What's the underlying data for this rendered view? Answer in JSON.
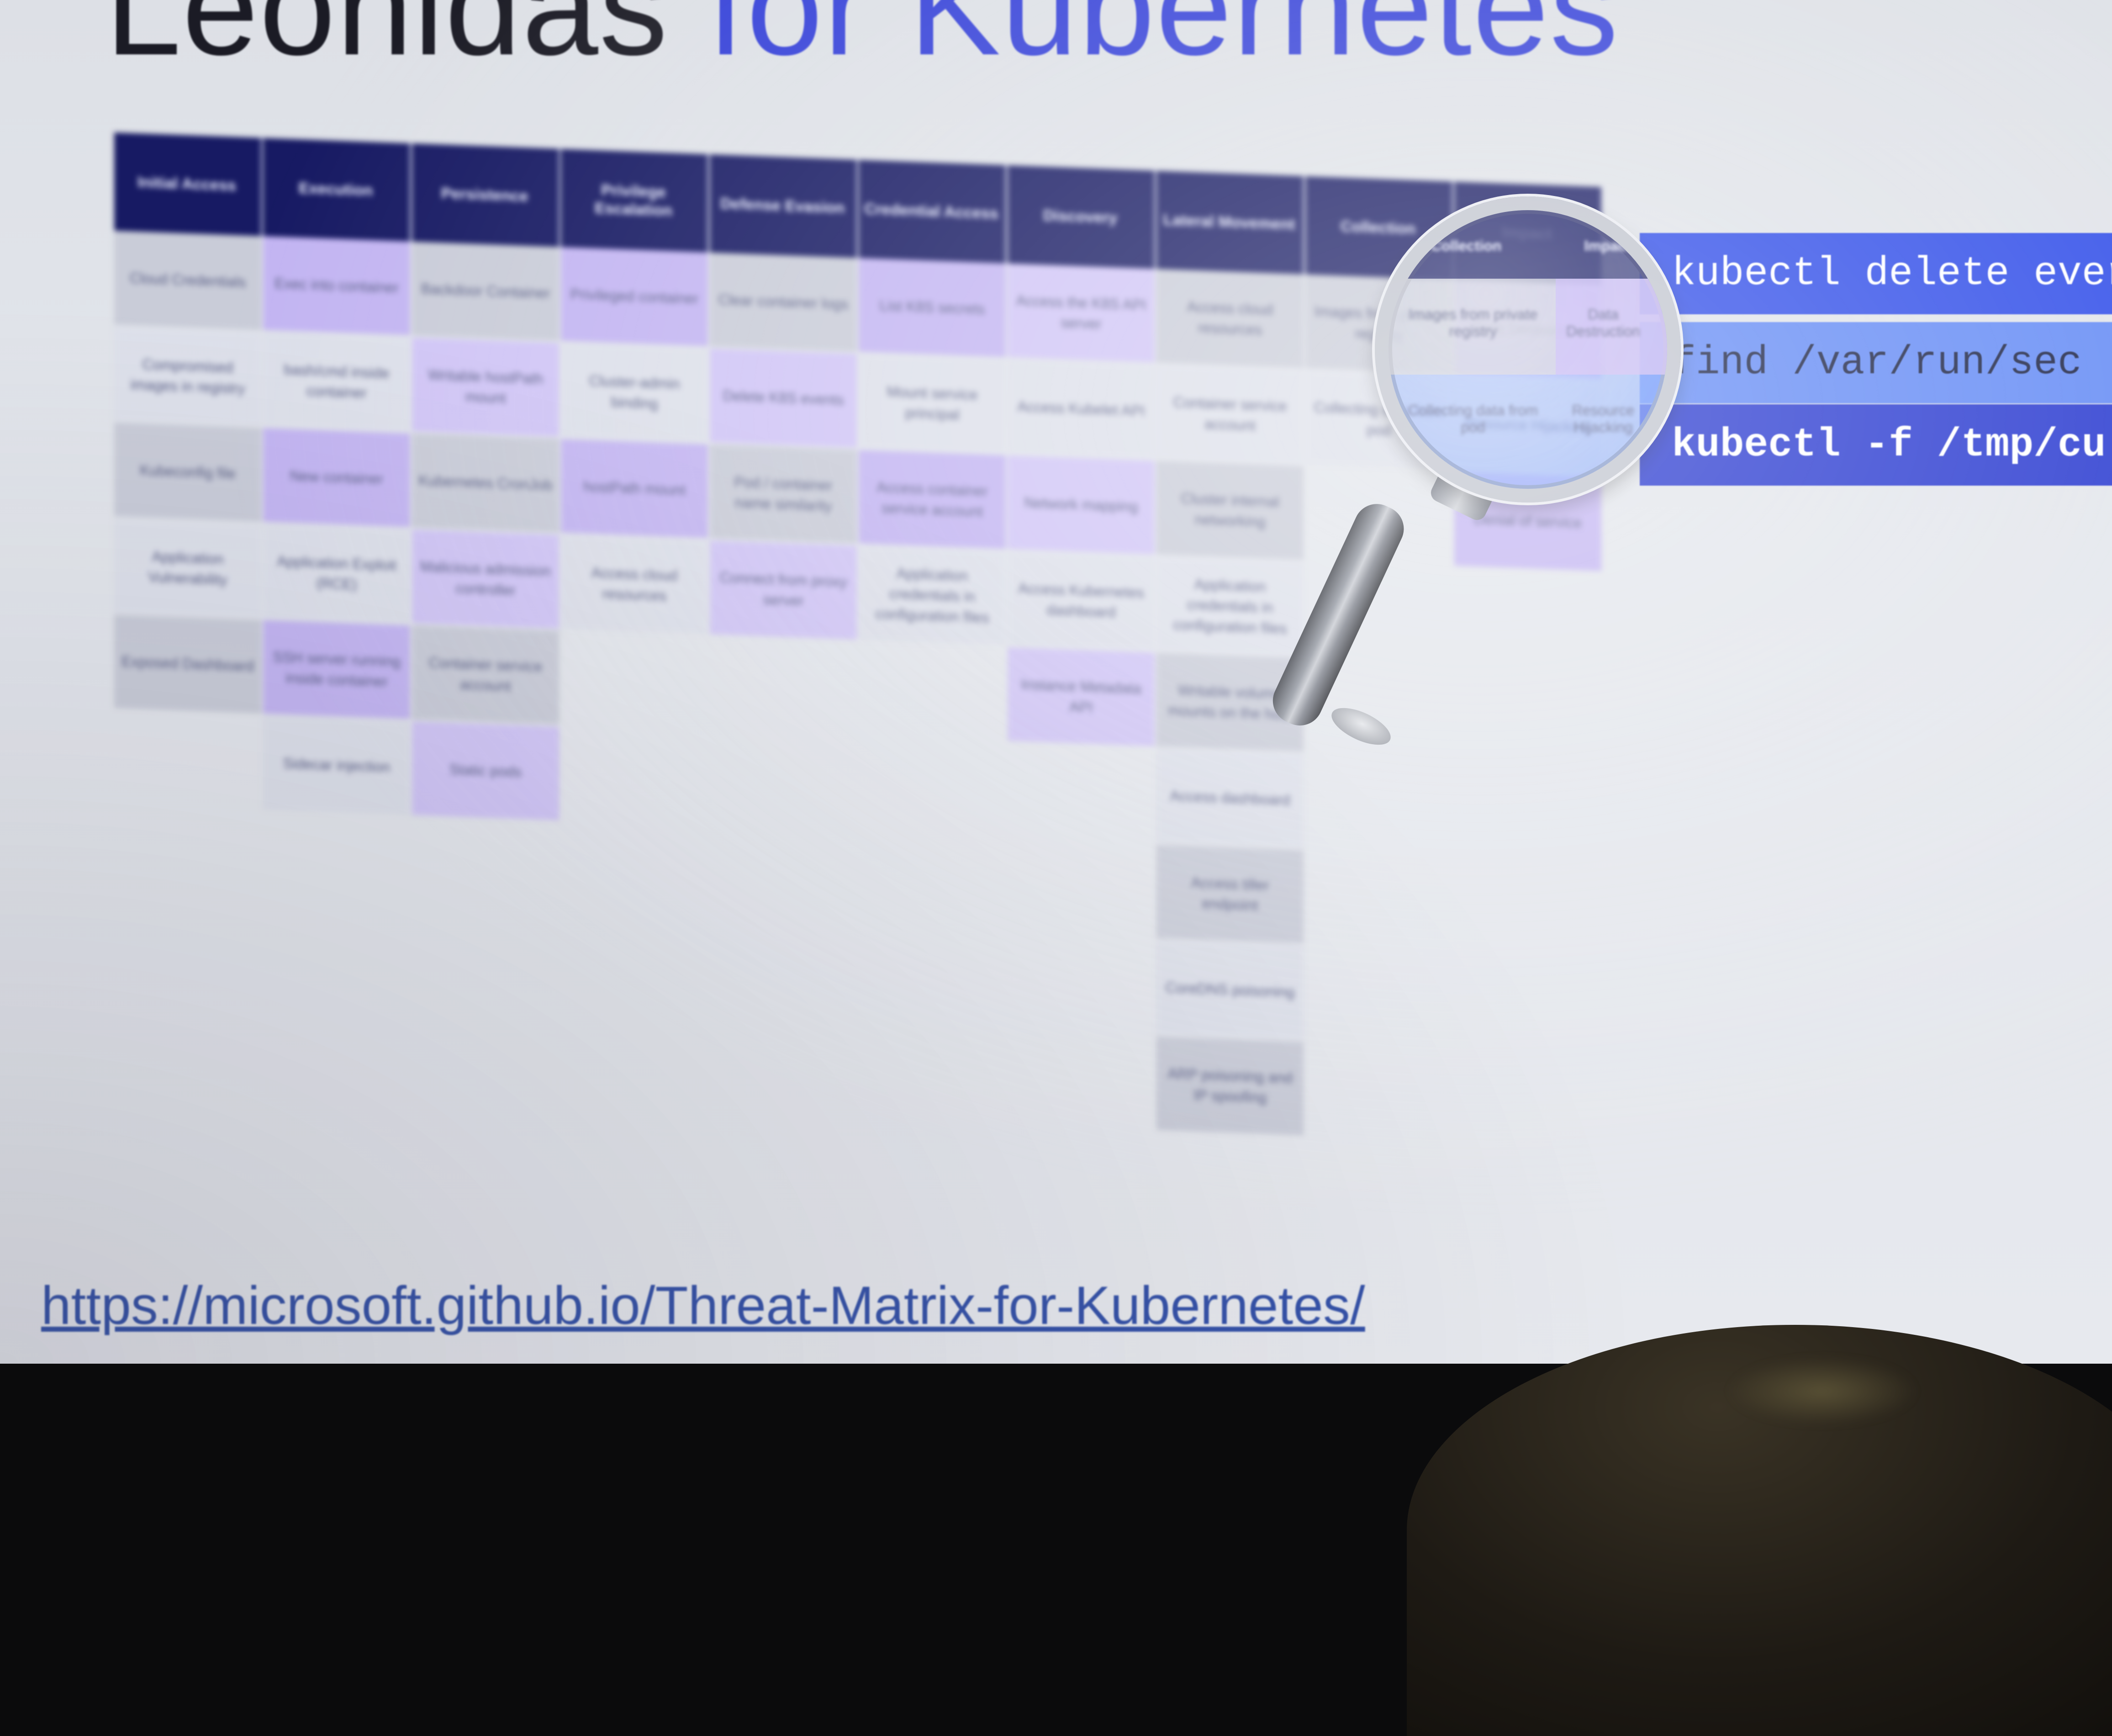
{
  "slide": {
    "title_part1": "Leonidas",
    "title_part2": "for Kubernetes",
    "url": "https://microsoft.github.io/Threat-Matrix-for-Kubernetes/"
  },
  "matrix": {
    "headers": [
      "Initial Access",
      "Execution",
      "Persistence",
      "Privilege Escalation",
      "Defense Evasion",
      "Credential Access",
      "Discovery",
      "Lateral Movement",
      "Collection",
      "Impact"
    ],
    "columns": [
      [
        "Cloud Credentials",
        "Compromised images in registry",
        "Kubeconfig file",
        "Application Vulnerability",
        "Exposed Dashboard"
      ],
      [
        "Exec into container",
        "bash/cmd inside container",
        "New container",
        "Application Exploit (RCE)",
        "SSH server running inside container",
        "Sidecar injection"
      ],
      [
        "Backdoor Container",
        "Writable hostPath mount",
        "Kubernetes CronJob",
        "Malicious admission controller",
        "Container service account",
        "Static pods"
      ],
      [
        "Privileged container",
        "Cluster-admin binding",
        "hostPath mount",
        "Access cloud resources"
      ],
      [
        "Clear container logs",
        "Delete K8S events",
        "Pod / container name similarity",
        "Connect from proxy server"
      ],
      [
        "List K8S secrets",
        "Mount service principal",
        "Access container service account",
        "Application credentials in configuration files"
      ],
      [
        "Access the K8S API server",
        "Access Kubelet API",
        "Network mapping",
        "Access Kubernetes dashboard",
        "Instance Metadata API"
      ],
      [
        "Access cloud resources",
        "Container service account",
        "Cluster internal networking",
        "Application credentials in configuration files",
        "Writable volume mounts on the host",
        "Access dashboard",
        "Access tiller endpoint",
        "CoreDNS poisoning",
        "ARP poisoning and IP spoofing"
      ],
      [
        "Images from private registry",
        "Collecting data from pod"
      ],
      [
        "Data Destruction",
        "Resource Hijacking",
        "Denial of service"
      ]
    ]
  },
  "commands": [
    "kubectl delete ever",
    "find /var/run/sec",
    "kubectl -f /tmp/cu"
  ]
}
